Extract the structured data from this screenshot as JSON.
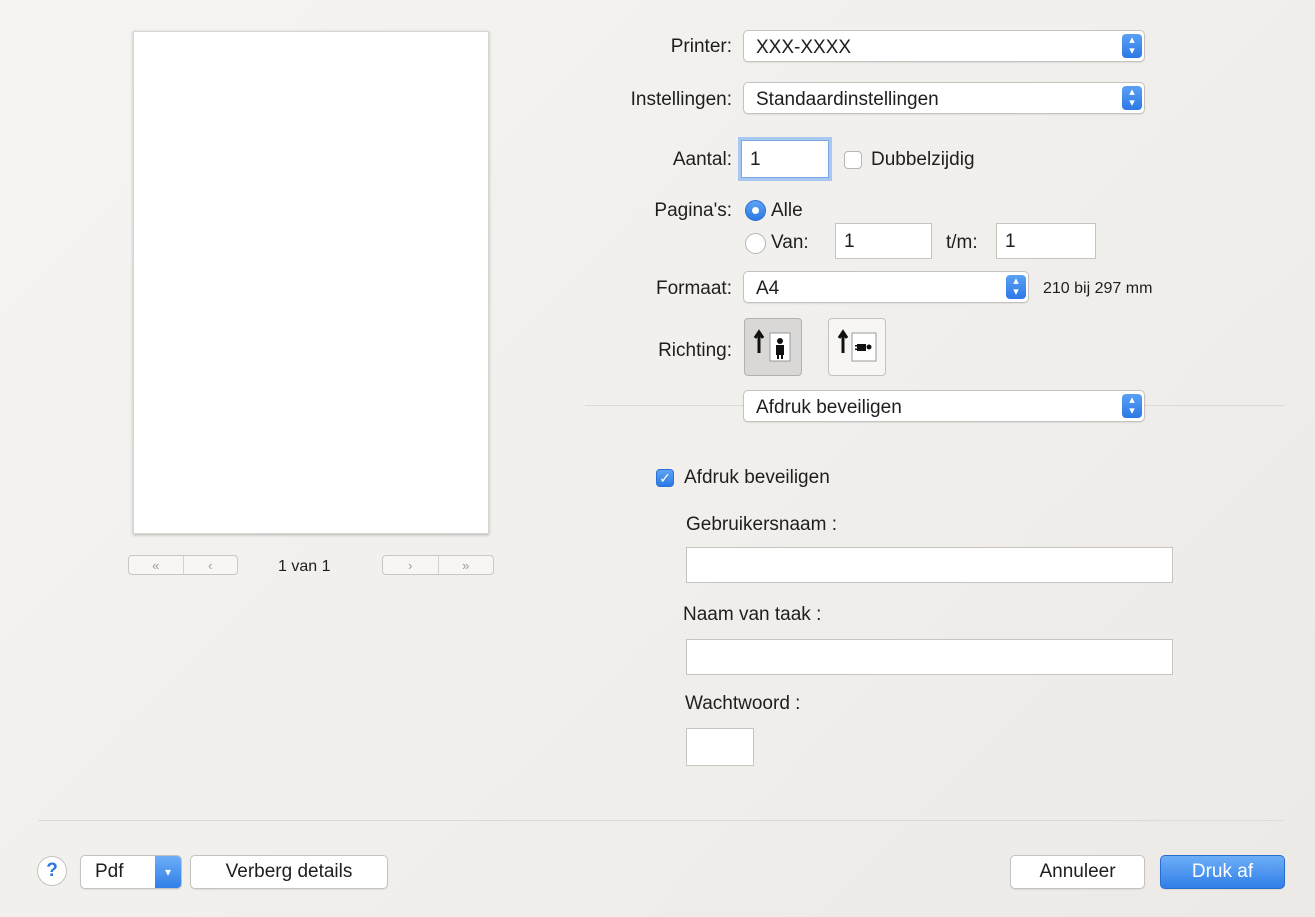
{
  "preview": {
    "page_indicator": "1 van 1",
    "nav": {
      "first": "«",
      "prev": "‹",
      "next": "›",
      "last": "»"
    }
  },
  "printer": {
    "label": "Printer:",
    "value": "XXX-XXXX"
  },
  "presets": {
    "label": "Instellingen:",
    "value": "Standaardinstellingen"
  },
  "copies": {
    "label": "Aantal:",
    "value": "1",
    "two_sided_label": "Dubbelzijdig",
    "two_sided_checked": false
  },
  "pages": {
    "label": "Pagina's:",
    "all_label": "Alle",
    "all_selected": true,
    "from_label": "Van:",
    "from_value": "1",
    "to_label": "t/m:",
    "to_value": "1"
  },
  "paper": {
    "label": "Formaat:",
    "value": "A4",
    "dimensions": "210 bij 297 mm"
  },
  "orientation": {
    "label": "Richting:",
    "options": [
      "portrait",
      "landscape"
    ],
    "selected": "portrait"
  },
  "panel_select": {
    "value": "Afdruk beveiligen"
  },
  "secure": {
    "checkbox_label": "Afdruk beveiligen",
    "checked": true,
    "username_label": "Gebruikersnaam :",
    "username_value": "",
    "jobname_label": "Naam van taak :",
    "jobname_value": "",
    "password_label": "Wachtwoord :",
    "password_value": ""
  },
  "footer": {
    "help": "?",
    "pdf": "Pdf",
    "hide_details": "Verberg details",
    "cancel": "Annuleer",
    "print": "Druk af"
  },
  "colors": {
    "accent": "#2f7fe8"
  }
}
